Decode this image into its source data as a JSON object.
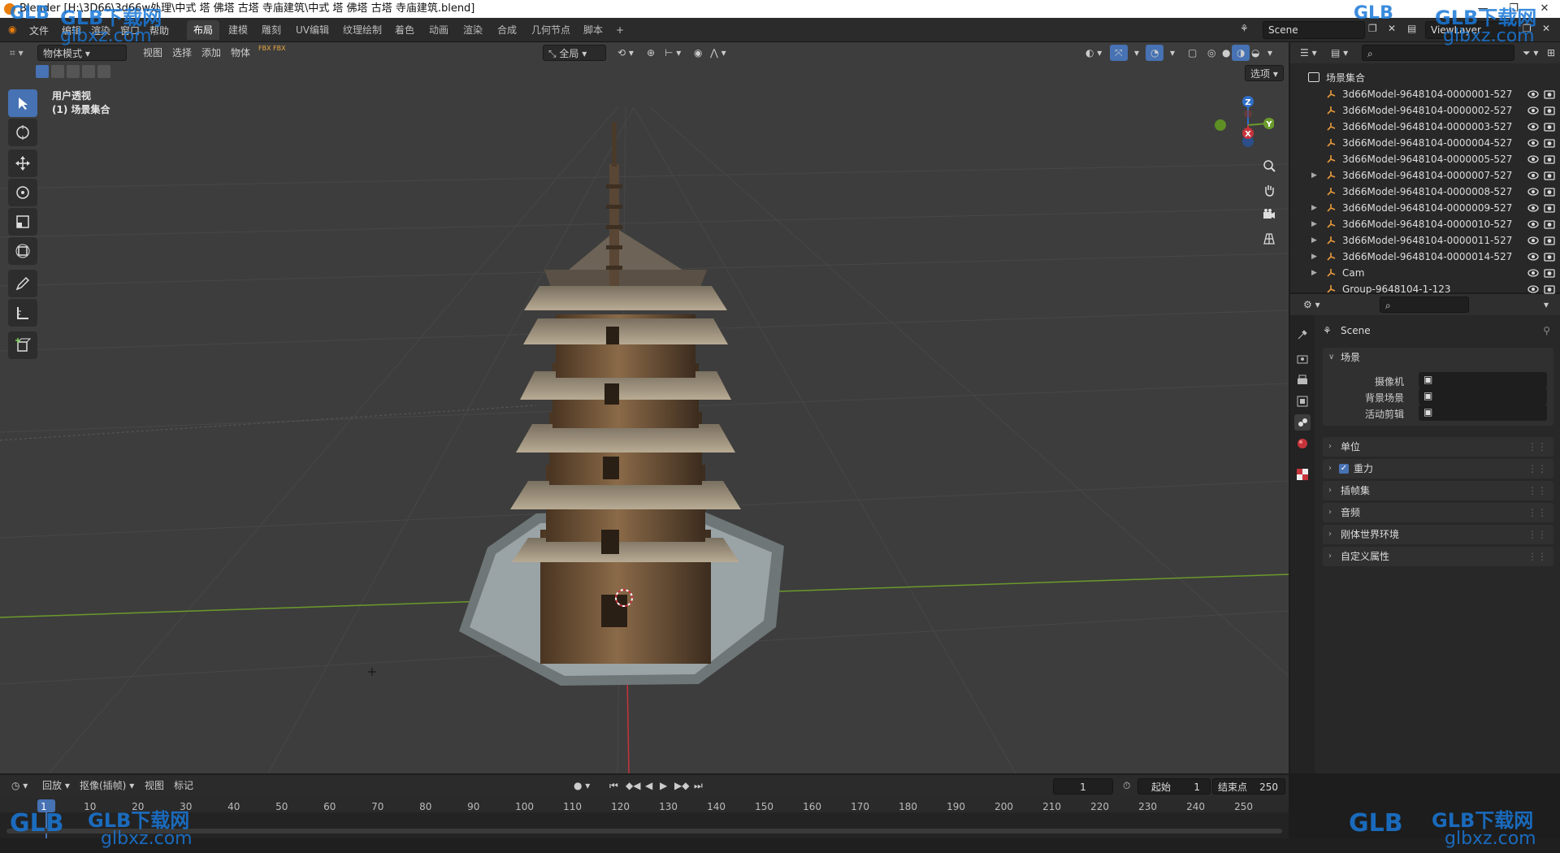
{
  "window": {
    "title": "Blender [H:\\3D66\\3d66w处理\\中式 塔 佛塔 古塔 寺庙建筑\\中式 塔 佛塔 古塔 寺庙建筑.blend]"
  },
  "menu": [
    "文件",
    "编辑",
    "渲染",
    "窗口",
    "帮助"
  ],
  "workspaces": [
    "布局",
    "建模",
    "雕刻",
    "UV编辑",
    "纹理绘制",
    "着色",
    "动画",
    "渲染",
    "合成",
    "几何节点",
    "脚本"
  ],
  "workspace_add": "+",
  "scene_field": "Scene",
  "viewlayer_field": "ViewLayer",
  "viewport": {
    "mode": "物体模式",
    "menus": [
      "视图",
      "选择",
      "添加",
      "物体"
    ],
    "fbx_label": "FBX",
    "transform_orientation": "全局",
    "options_label": "选项",
    "overlay_title": "用户透视",
    "overlay_subtitle": "(1) 场景集合",
    "gizmo": {
      "z": "Z",
      "y": "Y",
      "x": "X"
    },
    "colors": {
      "bg": "#3d3d3d",
      "x_axis": "#c5343b",
      "y_axis": "#6b9a2c",
      "z_axis": "#2f6fc9",
      "selected_tool": "#4772b3"
    }
  },
  "outliner": {
    "root": "场景集合",
    "items": [
      {
        "name": "3d66Model-9648104-0000001-527",
        "expandable": false
      },
      {
        "name": "3d66Model-9648104-0000002-527",
        "expandable": false
      },
      {
        "name": "3d66Model-9648104-0000003-527",
        "expandable": false
      },
      {
        "name": "3d66Model-9648104-0000004-527",
        "expandable": false
      },
      {
        "name": "3d66Model-9648104-0000005-527",
        "expandable": false
      },
      {
        "name": "3d66Model-9648104-0000007-527",
        "expandable": true
      },
      {
        "name": "3d66Model-9648104-0000008-527",
        "expandable": false
      },
      {
        "name": "3d66Model-9648104-0000009-527",
        "expandable": true
      },
      {
        "name": "3d66Model-9648104-0000010-527",
        "expandable": true
      },
      {
        "name": "3d66Model-9648104-0000011-527",
        "expandable": true
      },
      {
        "name": "3d66Model-9648104-0000014-527",
        "expandable": true
      },
      {
        "name": "Cam",
        "expandable": true
      },
      {
        "name": "Group-9648104-1-123",
        "expandable": false
      }
    ]
  },
  "properties": {
    "scene_name": "Scene",
    "section_scene": "场景",
    "fields": [
      {
        "label": "摄像机",
        "value": ""
      },
      {
        "label": "背景场景",
        "value": ""
      },
      {
        "label": "活动剪辑",
        "value": ""
      }
    ],
    "panels": [
      {
        "label": "单位",
        "checkbox": false
      },
      {
        "label": "重力",
        "checkbox": true
      },
      {
        "label": "插帧集",
        "checkbox": false
      },
      {
        "label": "音频",
        "checkbox": false
      },
      {
        "label": "刚体世界环境",
        "checkbox": false
      },
      {
        "label": "自定义属性",
        "checkbox": false
      }
    ]
  },
  "timeline": {
    "menus": [
      "回放",
      "抠像(插帧)",
      "视图",
      "标记"
    ],
    "current_frame": "1",
    "start_label": "起始",
    "start_value": "1",
    "end_label": "结束点",
    "end_value": "250",
    "ticks": [
      "1",
      "10",
      "20",
      "30",
      "40",
      "50",
      "60",
      "70",
      "80",
      "90",
      "100",
      "110",
      "120",
      "130",
      "140",
      "150",
      "160",
      "170",
      "180",
      "190",
      "200",
      "210",
      "220",
      "230",
      "240",
      "250"
    ]
  },
  "watermark": {
    "brand": "GLB下载网",
    "logo": "GLB",
    "url": "glbxz.com",
    "color": "#1a78d8"
  }
}
